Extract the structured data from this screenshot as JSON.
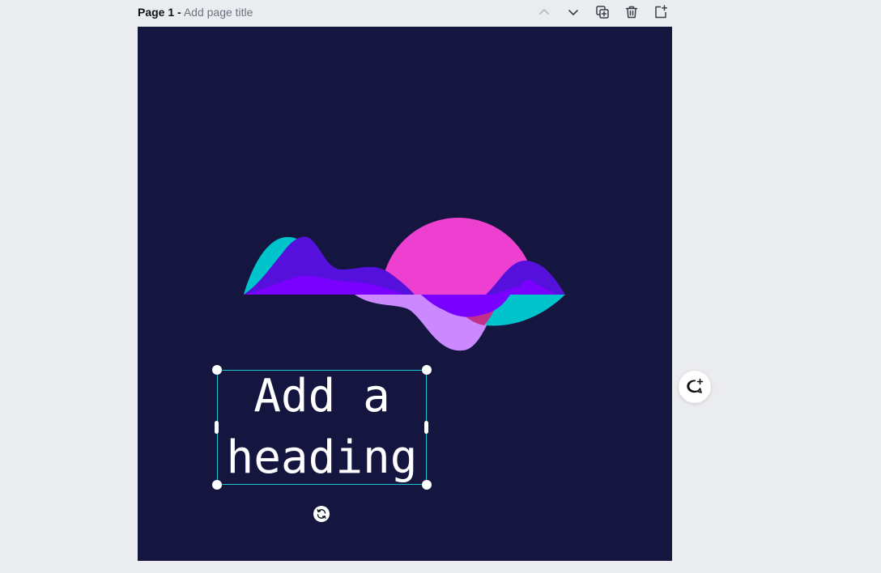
{
  "page_header": {
    "page_number_label": "Page 1",
    "separator": "-",
    "title_placeholder": "Add page title"
  },
  "page_actions": [
    {
      "name": "move-page-up",
      "icon": "chevron-up-icon",
      "enabled": false
    },
    {
      "name": "move-page-down",
      "icon": "chevron-down-icon",
      "enabled": true
    },
    {
      "name": "duplicate-page",
      "icon": "duplicate-icon",
      "enabled": true
    },
    {
      "name": "delete-page",
      "icon": "trash-icon",
      "enabled": true
    },
    {
      "name": "add-page",
      "icon": "add-page-icon",
      "enabled": true
    }
  ],
  "canvas": {
    "background_color": "#141640",
    "heading_text": "Add a\nheading",
    "heading_color": "#ffffff",
    "selection_color": "#18c6d4"
  },
  "graphic_colors": {
    "pink": "#ee40d0",
    "cyan": "#00c4cc",
    "indigo": "#5510dc",
    "violet": "#7a00ff",
    "lavender": "#cc88ff",
    "magenta": "#c2308a"
  },
  "floating_controls": {
    "comment_icon": "add-comment-icon",
    "rotate_icon": "rotate-icon"
  }
}
